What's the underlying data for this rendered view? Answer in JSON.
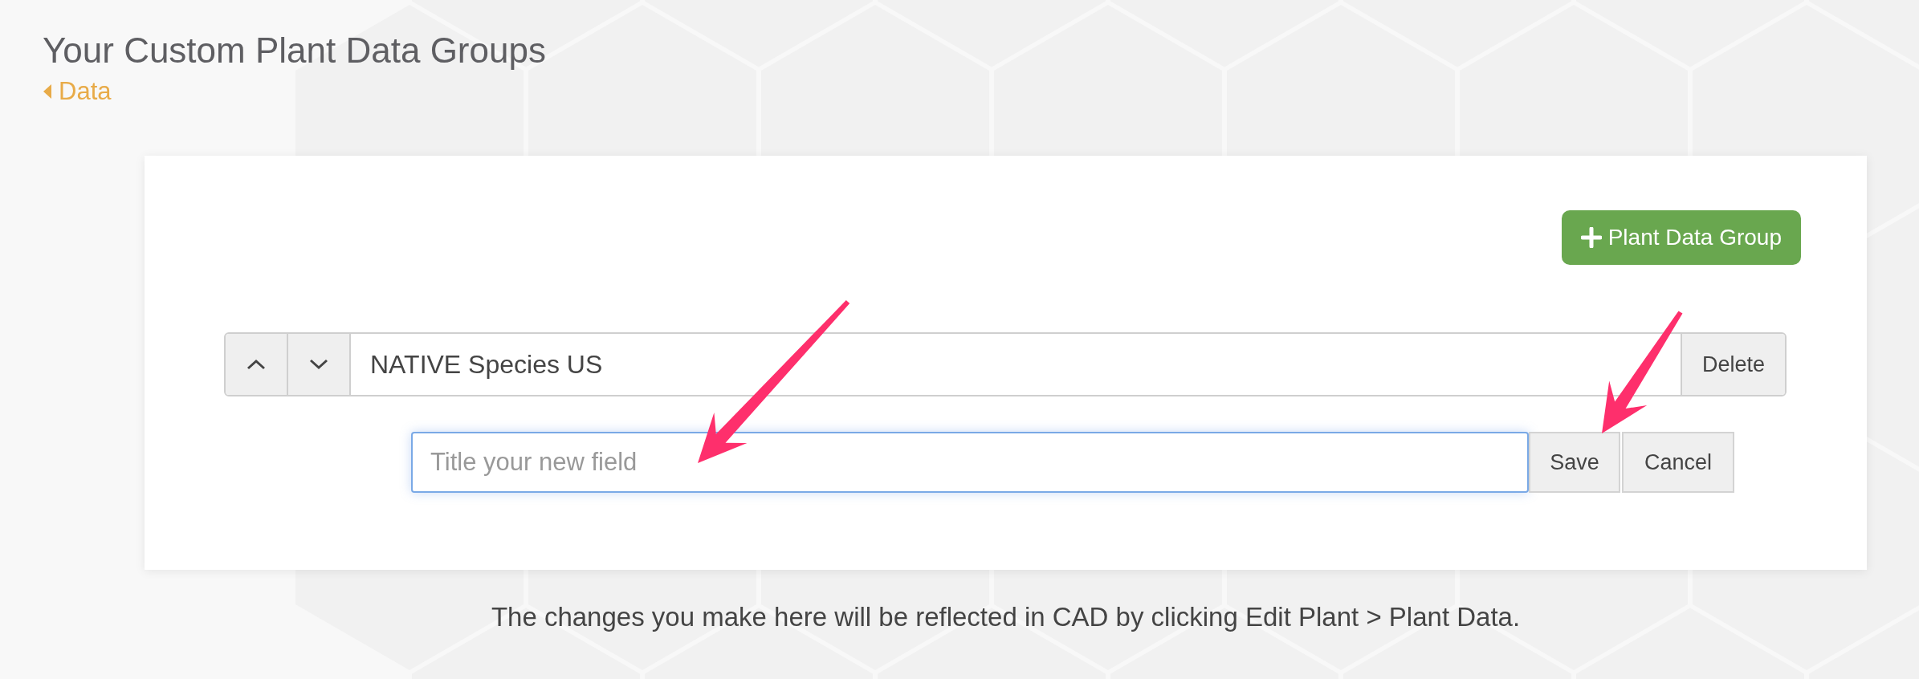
{
  "page": {
    "title": "Your Custom Plant Data Groups",
    "back_link": "Data"
  },
  "add_button": {
    "label": "Plant Data Group"
  },
  "groups": [
    {
      "name": "NATIVE Species US",
      "delete_label": "Delete"
    }
  ],
  "new_field": {
    "placeholder": "Title your new field",
    "save_label": "Save",
    "cancel_label": "Cancel"
  },
  "footer": "The changes you make here will be reflected in CAD by clicking Edit Plant > Plant Data."
}
